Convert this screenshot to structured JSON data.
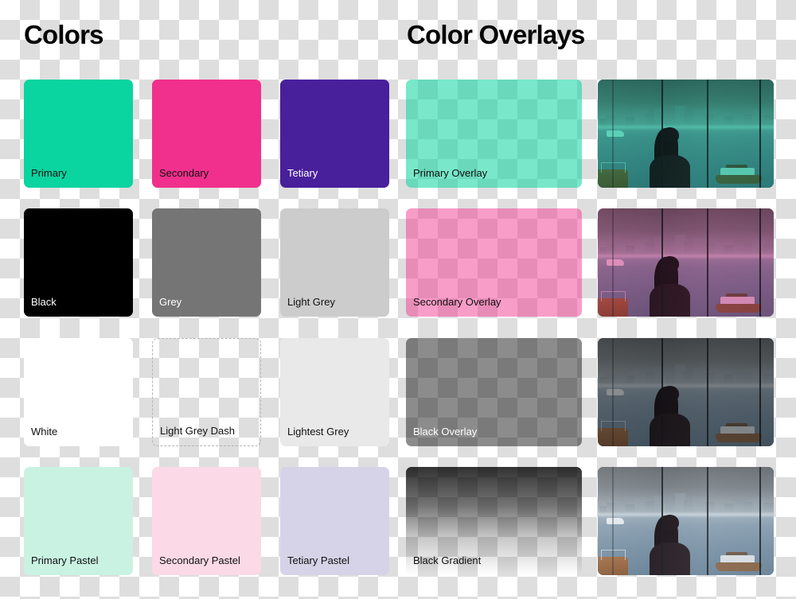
{
  "sections": {
    "colors_title": "Colors",
    "overlays_title": "Color Overlays"
  },
  "palette": [
    {
      "label": "Primary",
      "hex": "#0ad49f",
      "text": "dark",
      "style": "solid"
    },
    {
      "label": "Secondary",
      "hex": "#f0308c",
      "text": "dark",
      "style": "solid"
    },
    {
      "label": "Tetiary",
      "hex": "#48209b",
      "text": "light",
      "style": "solid"
    },
    {
      "label": "Black",
      "hex": "#000000",
      "text": "light",
      "style": "solid"
    },
    {
      "label": "Grey",
      "hex": "#757575",
      "text": "light",
      "style": "solid"
    },
    {
      "label": "Light Grey",
      "hex": "#cccccc",
      "text": "dark",
      "style": "solid"
    },
    {
      "label": "White",
      "hex": "#ffffff",
      "text": "dark",
      "style": "solid"
    },
    {
      "label": "Light Grey Dash",
      "hex": "#b3b3b3",
      "text": "dark",
      "style": "dashed"
    },
    {
      "label": "Lightest Grey",
      "hex": "#e9e9e9",
      "text": "dark",
      "style": "solid"
    },
    {
      "label": "Primary Pastel",
      "hex": "#c9f2e3",
      "text": "dark",
      "style": "solid"
    },
    {
      "label": "Secondary Pastel",
      "hex": "#fbd9e6",
      "text": "dark",
      "style": "solid"
    },
    {
      "label": "Tetiary Pastel",
      "hex": "#d6d3e8",
      "text": "dark",
      "style": "solid"
    }
  ],
  "overlays": [
    {
      "label": "Primary Overlay",
      "hex": "#0ad49f",
      "opacity": "0.55",
      "text": "dark",
      "kind": "flat",
      "photo_tint": "rgba(10,212,159,0.62)",
      "photo_blend": "multiply"
    },
    {
      "label": "Secondary Overlay",
      "hex": "#f0308c",
      "opacity": "0.48",
      "text": "dark",
      "kind": "flat",
      "photo_tint": "rgba(240,48,140,0.48)",
      "photo_blend": "multiply"
    },
    {
      "label": "Black Overlay",
      "hex": "#000000",
      "opacity": "0.45",
      "text": "light",
      "kind": "flat",
      "photo_tint": "rgba(0,0,0,0.40)",
      "photo_blend": "normal"
    },
    {
      "label": "Black Gradient",
      "hex": "#000000",
      "opacity": "0.80",
      "text": "dark",
      "kind": "gradient",
      "gradient": "linear-gradient(rgba(0,0,0,0.80) 0%, rgba(0,0,0,0.55) 35%, rgba(0,0,0,0.22) 65%, rgba(0,0,0,0.0) 100%)",
      "photo_tint": "rgba(0,0,0,0)",
      "photo_blend": "normal"
    }
  ],
  "canvas": {
    "checker_light": "#ffffff",
    "checker_dark": "#dedede",
    "checker_size_px": "25"
  },
  "photo": {
    "alt_name": "woman-at-window-harbor-photo",
    "subject": "woman silhouette at window",
    "scene": "city skyline across harbor with boats"
  }
}
